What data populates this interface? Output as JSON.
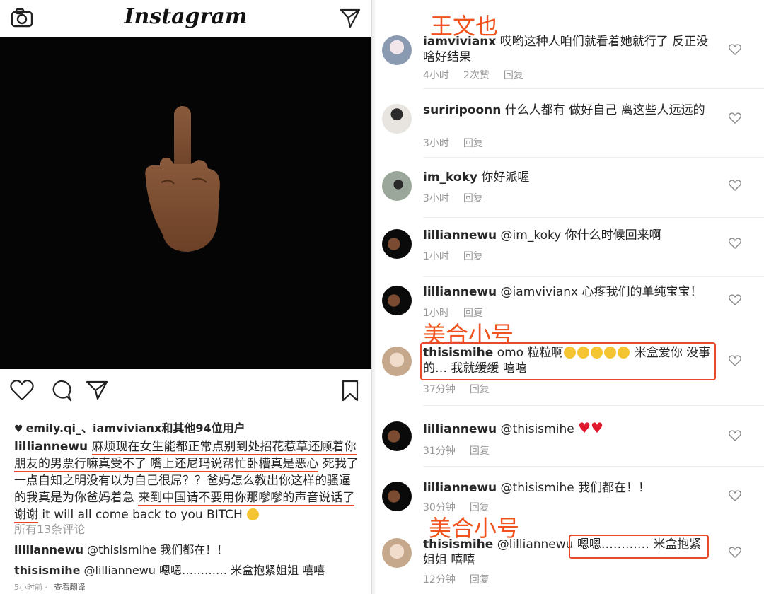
{
  "left": {
    "app_title": "Instagram",
    "liked_by": "emily.qi_、iamvivianx和其他94位用户",
    "caption": {
      "user": "lilliannewu",
      "seg1": "麻烦现在女生能都正常点别到处招花惹草还顾着你朋友的男票行嘛真受不了 嘴上还尼玛说帮忙卧槽真是恶心",
      "seg2": "死我了 一点自知之明没有以为自己很屌？？爸妈怎么教出你这样的骚逼的我真是为你爸妈着急 ",
      "seg3": "来到中国请不要用你那嗲嗲的声音说话了谢谢",
      "seg4": " it will all come back to you BITCH"
    },
    "all_comments": "所有13条评论",
    "comments": [
      {
        "user": "lilliannewu",
        "text": " @thisismihe 我们都在！！"
      },
      {
        "user": "thisismihe",
        "text": " @lilliannewu 嗯嗯………… 米盒抱紧姐姐 嘻嘻"
      }
    ],
    "time": "5小时前",
    "translate": "查看翻译"
  },
  "annotations": {
    "a1": "王文也",
    "a2": "美合小号",
    "a3": "美合小号"
  },
  "right_comments": [
    {
      "user": "iamvivianx",
      "text": " 哎哟这种人咱们就看着她就行了 反正没啥好结果",
      "time": "4小时",
      "likes": "2次赞",
      "reply": "回复"
    },
    {
      "user": "suriripoonn",
      "text": " 什么人都有 做好自己 离这些人远远的",
      "time": "3小时",
      "reply": "回复"
    },
    {
      "user": "im_koky",
      "text": " 你好派喔",
      "time": "3小时",
      "reply": "回复"
    },
    {
      "user": "lilliannewu",
      "text": " @im_koky 你什么时候回来啊",
      "time": "1小时",
      "reply": "回复"
    },
    {
      "user": "lilliannewu",
      "text": " @iamvivianx 心疼我们的单纯宝宝！",
      "time": "1小时",
      "reply": "回复"
    },
    {
      "user": "thisismihe",
      "text_a": " omo 粒粒啊",
      "text_b": " 米盒爱你 没事的… 我就缓缓 嘻嘻",
      "time": "37分钟",
      "reply": "回复"
    },
    {
      "user": "lilliannewu",
      "text": " @thisismihe ",
      "time": "31分钟",
      "reply": "回复"
    },
    {
      "user": "lilliannewu",
      "text": " @thisismihe 我们都在！！",
      "time": "30分钟",
      "reply": "回复"
    },
    {
      "user": "thisismihe",
      "text": " @lilliannewu 嗯嗯………… 米盒抱紧姐姐 嘻嘻",
      "time": "12分钟",
      "reply": "回复"
    }
  ]
}
